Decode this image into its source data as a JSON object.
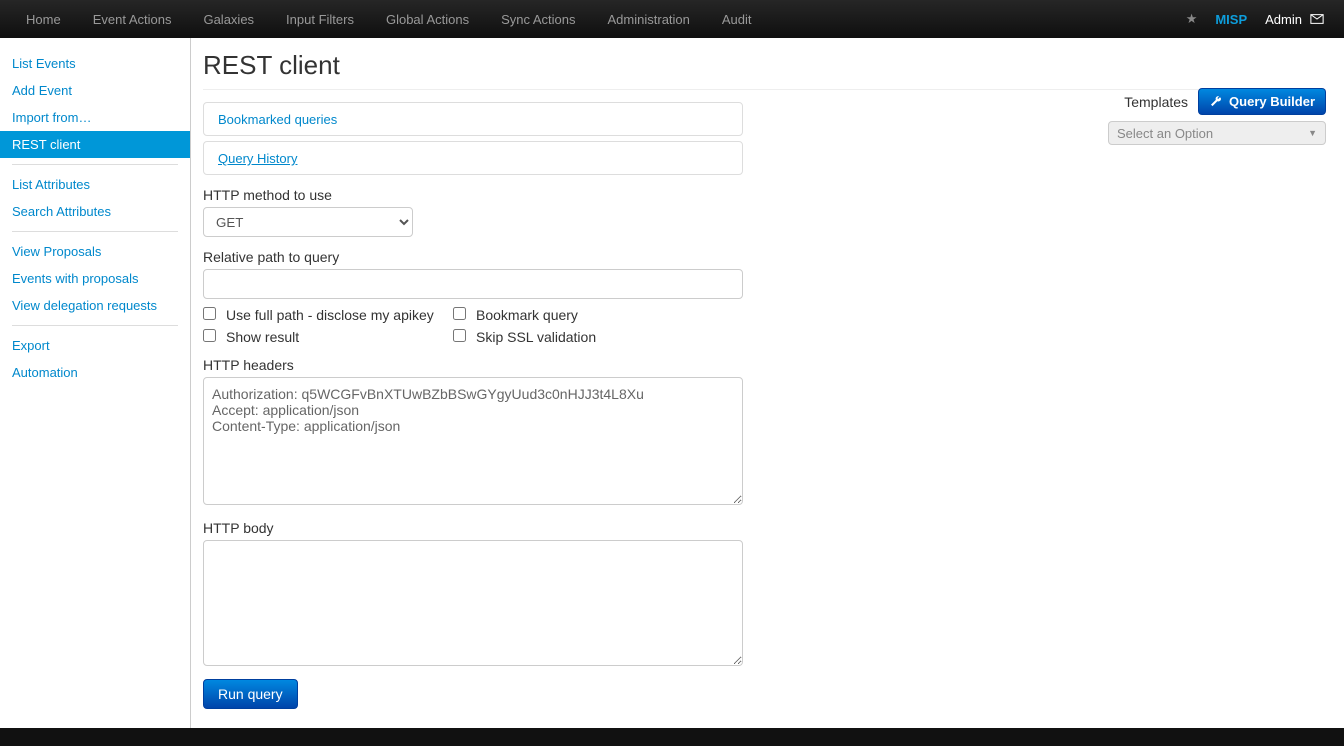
{
  "topnav": {
    "items": [
      "Home",
      "Event Actions",
      "Galaxies",
      "Input Filters",
      "Global Actions",
      "Sync Actions",
      "Administration",
      "Audit"
    ],
    "brand": "MISP",
    "user": "Admin"
  },
  "sidebar": {
    "groups": [
      [
        {
          "label": "List Events",
          "active": false
        },
        {
          "label": "Add Event",
          "active": false
        },
        {
          "label": "Import from…",
          "active": false
        },
        {
          "label": "REST client",
          "active": true
        }
      ],
      [
        {
          "label": "List Attributes",
          "active": false
        },
        {
          "label": "Search Attributes",
          "active": false
        }
      ],
      [
        {
          "label": "View Proposals",
          "active": false
        },
        {
          "label": "Events with proposals",
          "active": false
        },
        {
          "label": "View delegation requests",
          "active": false
        }
      ],
      [
        {
          "label": "Export",
          "active": false
        },
        {
          "label": "Automation",
          "active": false
        }
      ]
    ]
  },
  "page": {
    "title": "REST client",
    "templates_label": "Templates",
    "query_builder": "Query Builder",
    "select_placeholder": "Select an Option",
    "bookmarked_queries": "Bookmarked queries",
    "query_history": "Query History",
    "http_method_label": "HTTP method to use",
    "http_method_value": "GET",
    "relative_path_label": "Relative path to query",
    "relative_path_value": "",
    "checkboxes": {
      "full_path": "Use full path - disclose my apikey",
      "bookmark": "Bookmark query",
      "show_result": "Show result",
      "skip_ssl": "Skip SSL validation"
    },
    "headers_label": "HTTP headers",
    "headers_value": "Authorization: q5WCGFvBnXTUwBZbBSwGYgyUud3c0nHJJ3t4L8Xu\nAccept: application/json\nContent-Type: application/json",
    "body_label": "HTTP body",
    "body_value": "",
    "run_query": "Run query"
  }
}
